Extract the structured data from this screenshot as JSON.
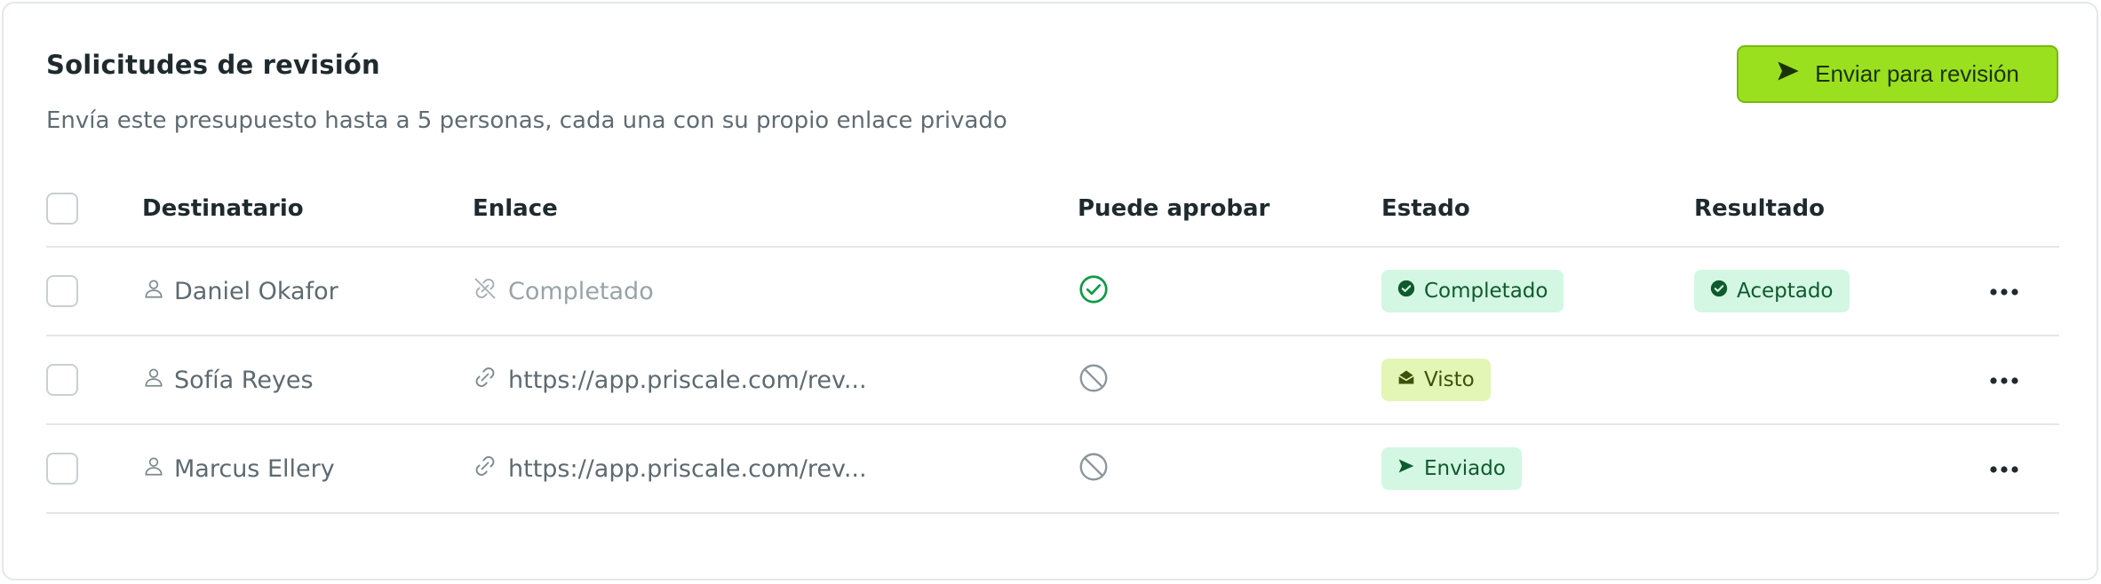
{
  "header": {
    "title": "Solicitudes de revisión",
    "subtitle": "Envía este presupuesto hasta a 5 personas, cada una con su propio enlace privado",
    "send_button": "Enviar para revisión"
  },
  "table": {
    "columns": {
      "recipient": "Destinatario",
      "link": "Enlace",
      "can_approve": "Puede aprobar",
      "state": "Estado",
      "result": "Resultado"
    },
    "rows": [
      {
        "name": "Daniel Okafor",
        "link": "Completado",
        "can_approve": true,
        "state": "Completado",
        "result": "Aceptado"
      },
      {
        "name": "Sofía Reyes",
        "link": "https://app.priscale.com/rev...",
        "can_approve": false,
        "state": "Visto",
        "result": ""
      },
      {
        "name": "Marcus Ellery",
        "link": "https://app.priscale.com/rev...",
        "can_approve": false,
        "state": "Enviado",
        "result": ""
      }
    ]
  },
  "colors": {
    "accent": "#9be01f",
    "success_bg": "#d3f7e3",
    "success_text": "#0f5a2e",
    "seen_bg": "#e3f6b6"
  }
}
